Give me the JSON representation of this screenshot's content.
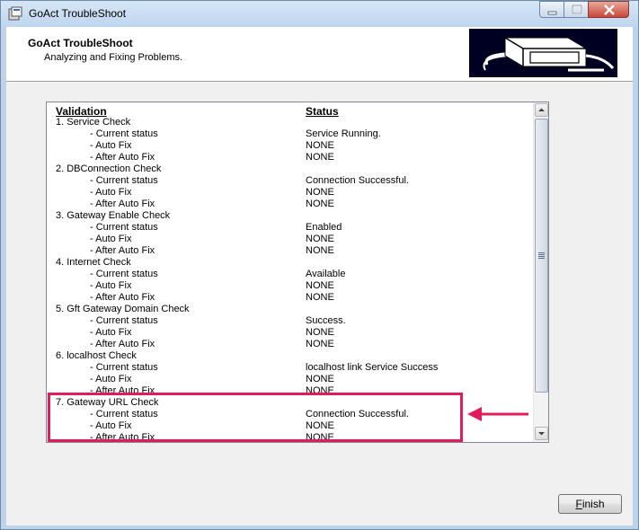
{
  "window": {
    "title": "GoAct TroubleShoot"
  },
  "header": {
    "title": "GoAct TroubleShoot",
    "subtitle": "Analyzing and Fixing Problems."
  },
  "list": {
    "columns": {
      "validation": "Validation",
      "status": "Status"
    },
    "rows": [
      {
        "label": "1. Service Check",
        "status": ""
      },
      {
        "label": "- Current status",
        "status": "Service Running."
      },
      {
        "label": "- Auto Fix",
        "status": "NONE"
      },
      {
        "label": "- After Auto Fix",
        "status": "NONE"
      },
      {
        "label": "2. DBConnection Check",
        "status": ""
      },
      {
        "label": "- Current status",
        "status": "Connection Successful."
      },
      {
        "label": "- Auto Fix",
        "status": "NONE"
      },
      {
        "label": "- After Auto Fix",
        "status": "NONE"
      },
      {
        "label": "3. Gateway Enable Check",
        "status": ""
      },
      {
        "label": "- Current status",
        "status": "Enabled"
      },
      {
        "label": "- Auto Fix",
        "status": "NONE"
      },
      {
        "label": "- After Auto Fix",
        "status": "NONE"
      },
      {
        "label": "4. Internet Check",
        "status": ""
      },
      {
        "label": "- Current status",
        "status": "Available"
      },
      {
        "label": "- Auto Fix",
        "status": "NONE"
      },
      {
        "label": "- After Auto Fix",
        "status": "NONE"
      },
      {
        "label": "5. Gft Gateway Domain Check",
        "status": ""
      },
      {
        "label": "- Current status",
        "status": "Success."
      },
      {
        "label": "- Auto Fix",
        "status": "NONE"
      },
      {
        "label": "- After Auto Fix",
        "status": "NONE"
      },
      {
        "label": "6. localhost Check",
        "status": ""
      },
      {
        "label": "- Current status",
        "status": "localhost link Service Success"
      },
      {
        "label": "- Auto Fix",
        "status": "NONE"
      },
      {
        "label": "- After Auto Fix",
        "status": "NONE"
      },
      {
        "label": "7. Gateway URL Check",
        "status": ""
      },
      {
        "label": "- Current status",
        "status": "Connection Successful."
      },
      {
        "label": "- Auto Fix",
        "status": "NONE"
      },
      {
        "label": "- After Auto Fix",
        "status": "NONE"
      }
    ]
  },
  "footer": {
    "finish_label_underlined": "F",
    "finish_label_rest": "inish"
  },
  "colors": {
    "highlight": "#e01c5b",
    "header_image_bg": "#000022"
  }
}
